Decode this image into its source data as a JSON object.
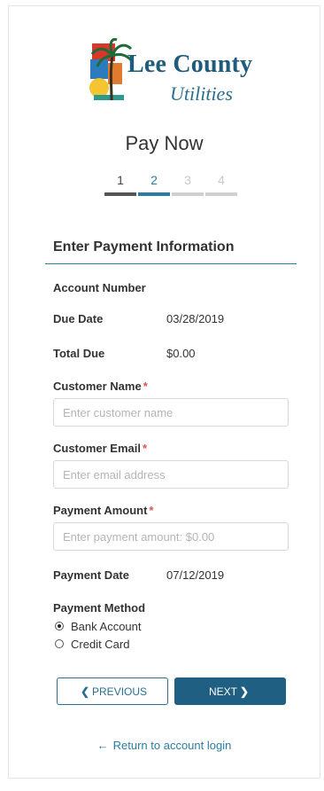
{
  "brand": {
    "line1": "Lee County",
    "line2": "Utilities",
    "colors": {
      "primary": "#1f5b7b",
      "accent": "#2a7da1"
    }
  },
  "page": {
    "title": "Pay Now"
  },
  "steps": [
    {
      "label": "1",
      "state": "done"
    },
    {
      "label": "2",
      "state": "active"
    },
    {
      "label": "3",
      "state": "todo"
    },
    {
      "label": "4",
      "state": "todo"
    }
  ],
  "section": {
    "title": "Enter Payment Information"
  },
  "account": {
    "number_label": "Account Number",
    "due_date_label": "Due Date",
    "due_date_value": "03/28/2019",
    "total_due_label": "Total Due",
    "total_due_value": "$0.00"
  },
  "form": {
    "customer_name": {
      "label": "Customer Name",
      "required_mark": "*",
      "placeholder": "Enter customer name",
      "value": ""
    },
    "customer_email": {
      "label": "Customer Email",
      "required_mark": "*",
      "placeholder": "Enter email address",
      "value": ""
    },
    "payment_amount": {
      "label": "Payment Amount",
      "required_mark": "*",
      "placeholder": "Enter payment amount: $0.00",
      "value": ""
    },
    "payment_date_label": "Payment Date",
    "payment_date_value": "07/12/2019",
    "payment_method": {
      "label": "Payment Method",
      "options": [
        {
          "label": "Bank Account",
          "selected": true
        },
        {
          "label": "Credit Card",
          "selected": false
        }
      ]
    }
  },
  "buttons": {
    "previous": {
      "label": "PREVIOUS",
      "icon": "chevron-left-icon"
    },
    "next": {
      "label": "NEXT",
      "icon": "chevron-right-icon"
    }
  },
  "footer": {
    "return_link": "Return to account login",
    "icon": "arrow-left-icon"
  }
}
